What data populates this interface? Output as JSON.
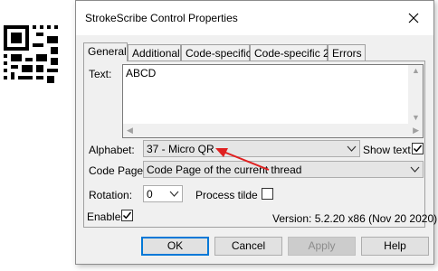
{
  "dialog": {
    "title": "StrokeScribe Control Properties"
  },
  "tabs": [
    "General",
    "Additional",
    "Code-specific",
    "Code-specific 2",
    "Errors"
  ],
  "text_field": {
    "label": "Text:",
    "value": "ABCD"
  },
  "alphabet": {
    "label": "Alphabet:",
    "value": "37 - Micro QR"
  },
  "show_text": {
    "label": "Show text",
    "checked": true
  },
  "code_page": {
    "label": "Code Page:",
    "value": "Code Page of the current thread"
  },
  "rotation": {
    "label": "Rotation:",
    "value": "0"
  },
  "process_tilde": {
    "label": "Process tilde",
    "checked": false
  },
  "enable": {
    "label": "Enable",
    "checked": true
  },
  "version": "Version: 5.2.20 x86 (Nov 20 2020)",
  "buttons": {
    "ok": "OK",
    "cancel": "Cancel",
    "apply": "Apply",
    "help": "Help"
  },
  "annotation": {
    "color": "#e02020"
  }
}
